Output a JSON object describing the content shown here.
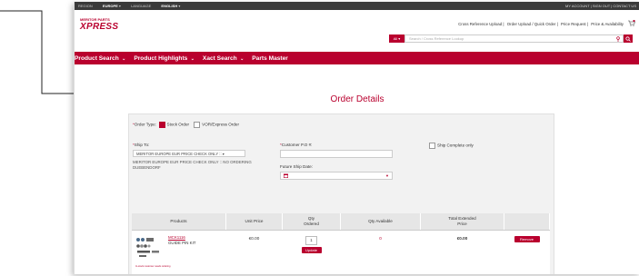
{
  "topbar": {
    "region_label": "REGION",
    "region_value": "EUROPE",
    "language_label": "LANGUAGE",
    "language_value": "ENGLISH",
    "right_links": "MY ACCOUNT | SIGN OUT | CONTACT US"
  },
  "logo": {
    "tag": "MERITOR PARTS",
    "brand": "XPRESS"
  },
  "header_links": [
    "Cross Reference Upload",
    "Order Upload / Quick Order",
    "Price Request",
    "Price & Availability"
  ],
  "search": {
    "scope": "All",
    "placeholder": "Search / Cross Reference Lookup"
  },
  "nav": [
    "Product Search",
    "Product Highlights",
    "Xact Search",
    "Parts Master"
  ],
  "page_title": "Order Details",
  "order_type": {
    "label": "Order Type:",
    "stock": "Stock Order",
    "vor": "VOR/Express Order"
  },
  "ship_to": {
    "label": "Ship To:",
    "selected": "MERITOR EUROPE EUR PRICE CHECK ONLY",
    "address_line1": "MERITOR EUROPE EUR PRICE CHECK ONLY :: NO ORDERING",
    "address_line2": "DUEBENDORF"
  },
  "po": {
    "label": "Customer P.O #:",
    "value": ""
  },
  "ship_complete": "Ship Complete only",
  "future_ship": {
    "label": "Future Ship Date:",
    "value": ""
  },
  "table": {
    "headers": [
      "Products",
      "Unit Price",
      "Qty Ordered",
      "Qty Available",
      "Total Extended Price",
      ""
    ],
    "row": {
      "part": "MCK1116",
      "desc": "GUIDE PIN KIT",
      "note": "In-stock customer needs ordering",
      "unit_price": "€0.00",
      "qty": "1",
      "available": "0",
      "total": "€0.00",
      "update": "Update",
      "remove": "Remove"
    }
  },
  "colors": {
    "brand": "#b9002e",
    "topbar": "#3a3a3a"
  }
}
